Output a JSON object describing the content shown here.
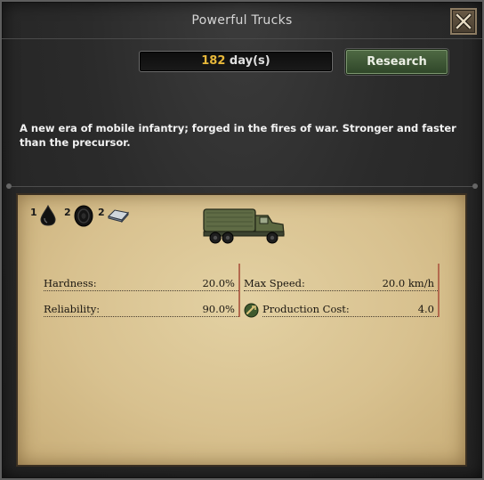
{
  "window": {
    "title": "Powerful Trucks"
  },
  "research": {
    "days_value": "182",
    "days_unit": " day(s)",
    "button_label": "Research"
  },
  "description": "A new era of mobile infantry; forged in the fires of war. Stronger and faster than the precursor.",
  "resources": [
    {
      "count": "1",
      "icon": "oil-drop-icon"
    },
    {
      "count": "2",
      "icon": "rubber-tire-icon"
    },
    {
      "count": "2",
      "icon": "steel-ingot-icon"
    }
  ],
  "unit_image": "army-truck-icon",
  "stats": {
    "hardness": {
      "label": "Hardness:",
      "value": "20.0%"
    },
    "max_speed": {
      "label": "Max Speed:",
      "value": "20.0 km/h"
    },
    "reliability": {
      "label": "Reliability:",
      "value": "90.0%"
    },
    "production_cost": {
      "label": "Production Cost:",
      "value": "4.0",
      "icon": "production-cost-icon"
    }
  },
  "colors": {
    "days_accent": "#e8b83a",
    "research_button": "#3f5a36",
    "parchment": "#dcc894",
    "column_divider": "#b46a4f"
  }
}
